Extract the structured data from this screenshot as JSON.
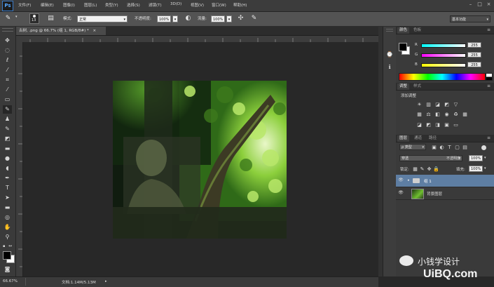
{
  "app": {
    "logo": "Ps"
  },
  "menu": [
    "文件(F)",
    "编辑(E)",
    "图像(I)",
    "图层(L)",
    "类型(Y)",
    "选择(S)",
    "滤镜(T)",
    "3D(D)",
    "视图(V)",
    "窗口(W)",
    "帮助(H)"
  ],
  "window_controls": {
    "minimize": "–",
    "restore": "□",
    "close": "×"
  },
  "options": {
    "brush_size": "13",
    "mode_label": "模式:",
    "mode_value": "正常",
    "opacity_label": "不透明度:",
    "opacity_value": "100%",
    "flow_label": "流量:",
    "flow_value": "100%",
    "workspace": "基本功能"
  },
  "document": {
    "tab": "古树, .png @ 66.7% (组 1, RGB/8#) *",
    "close": "×"
  },
  "status": {
    "zoom": "66.67%",
    "doc": "文档:1.14M/5.13M"
  },
  "color_panel": {
    "tabs": [
      "颜色",
      "色板"
    ],
    "r_label": "R",
    "r_value": "255",
    "g_label": "G",
    "g_value": "255",
    "b_label": "B",
    "b_value": "255",
    "fg_color": "#000000",
    "bg_color": "#ffffff"
  },
  "adjustments_panel": {
    "tabs": [
      "调整",
      "样式"
    ],
    "title": "添加调整"
  },
  "layers_panel": {
    "tabs": [
      "图层",
      "通道",
      "路径"
    ],
    "filter_kind": "ρ 类型",
    "blend_mode": "穿透",
    "opacity_label": "不透明度:",
    "opacity_value": "100%",
    "lock_label": "锁定:",
    "fill_label": "填充:",
    "fill_value": "100%",
    "layers": [
      {
        "name": "组 1",
        "selected": true,
        "type": "group"
      },
      {
        "name": "背景图层",
        "selected": false,
        "type": "image"
      }
    ]
  },
  "watermark": {
    "text": "小钱学设计",
    "logo": "UiBQ.com"
  }
}
